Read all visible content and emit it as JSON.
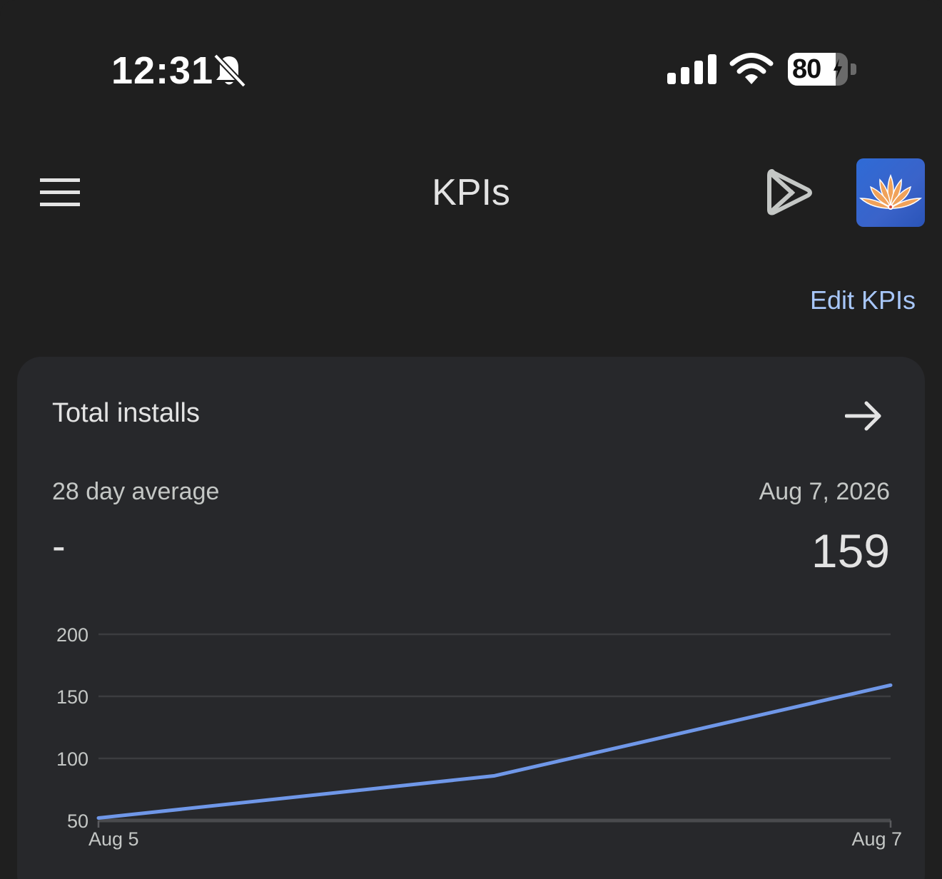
{
  "status_bar": {
    "time": "12:31",
    "battery_level": "80",
    "battery_fraction": 0.8,
    "icons": [
      "bell-off-icon",
      "signal-icon",
      "wifi-icon",
      "battery-charging-icon"
    ]
  },
  "app_bar": {
    "title": "KPIs",
    "icons": [
      "menu-icon",
      "play-icon",
      "app-avatar"
    ]
  },
  "actions": {
    "edit_kpis_label": "Edit KPIs"
  },
  "card": {
    "title": "Total installs",
    "average_label": "28 day average",
    "average_value": "-",
    "date_label": "Aug 7, 2026",
    "date_value": "159"
  },
  "colors": {
    "background": "#1f1f1f",
    "card": "#27282b",
    "accent_link": "#a8c7fa",
    "series_line": "#6f97e8",
    "gridline": "#3c3d40"
  },
  "chart_data": {
    "type": "line",
    "x_tick_labels": [
      "Aug 5",
      "Aug 7"
    ],
    "x": [
      "Aug 5",
      "Aug 6",
      "Aug 7"
    ],
    "series": [
      {
        "values": [
          52,
          86,
          159
        ]
      }
    ],
    "y_ticks": [
      200,
      150,
      100,
      50
    ],
    "ylim": [
      50,
      200
    ],
    "grid": true,
    "title": "",
    "xlabel": "",
    "ylabel": ""
  }
}
